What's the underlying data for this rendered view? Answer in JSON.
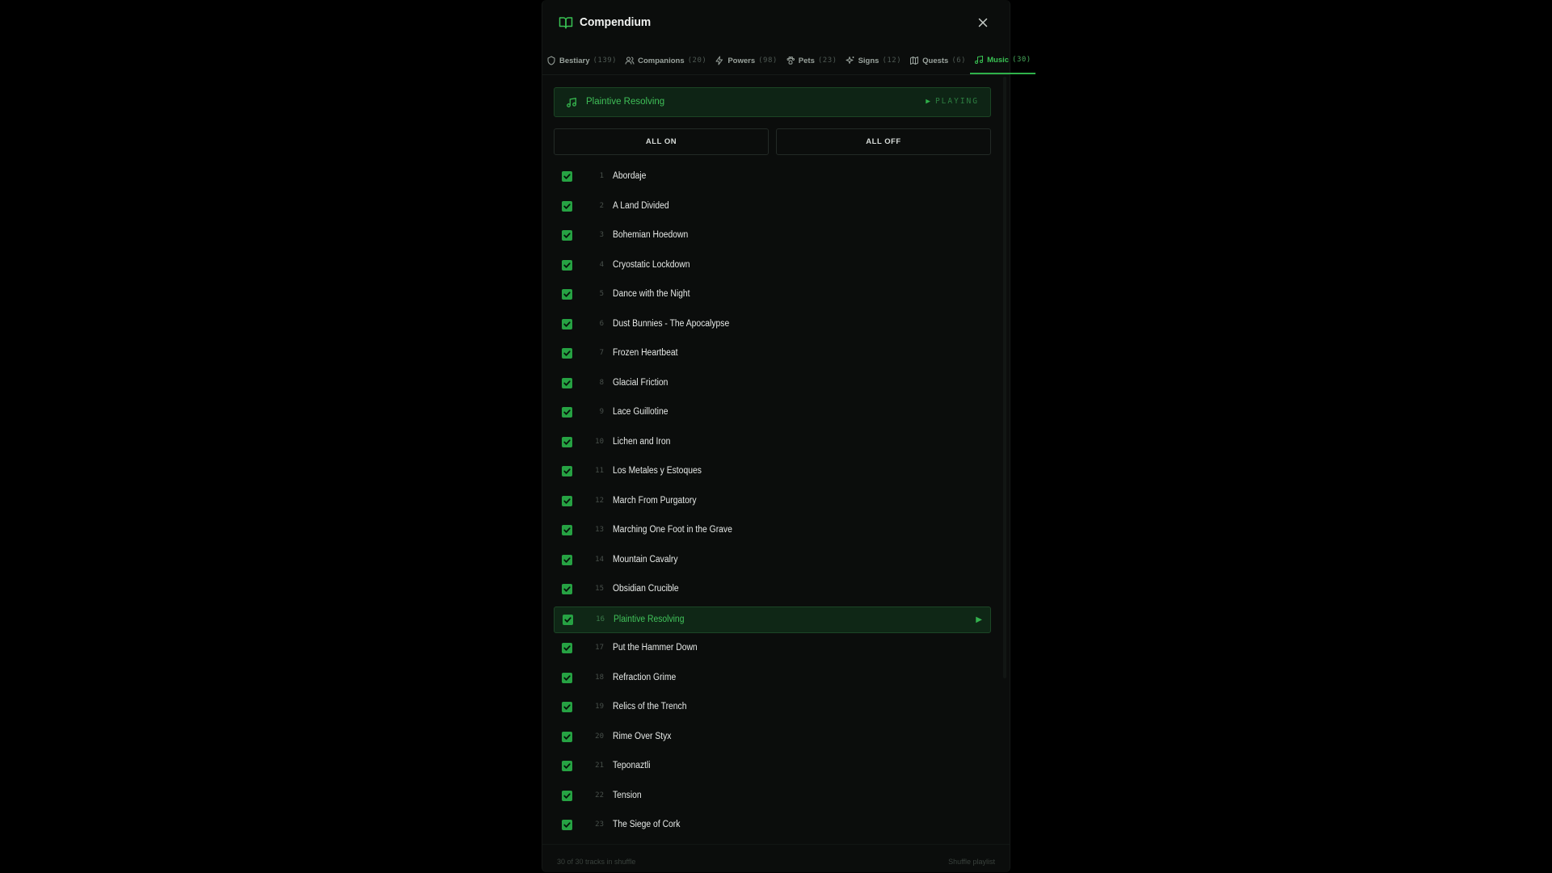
{
  "header": {
    "title": "Compendium",
    "book_icon": "book-open-icon",
    "close_icon": "close-icon"
  },
  "tabs": [
    {
      "label": "Bestiary",
      "count": "(139)",
      "icon": "shield-icon",
      "active": false
    },
    {
      "label": "Companions",
      "count": "(20)",
      "icon": "users-icon",
      "active": false
    },
    {
      "label": "Powers",
      "count": "(98)",
      "icon": "bolt-icon",
      "active": false
    },
    {
      "label": "Pets",
      "count": "(23)",
      "icon": "paw-icon",
      "active": false
    },
    {
      "label": "Signs",
      "count": "(12)",
      "icon": "sparkles-icon",
      "active": false
    },
    {
      "label": "Quests",
      "count": "(6)",
      "icon": "map-icon",
      "active": false
    },
    {
      "label": "Music",
      "count": "(30)",
      "icon": "music-icon",
      "active": true
    }
  ],
  "now_playing": {
    "title": "Plaintive Resolving",
    "status": "PLAYING",
    "icon": "music-icon"
  },
  "controls": {
    "all_on": "ALL ON",
    "all_off": "ALL OFF"
  },
  "tracks": [
    {
      "num": "1",
      "name": "Abordaje",
      "checked": true
    },
    {
      "num": "2",
      "name": "A Land Divided",
      "checked": true
    },
    {
      "num": "3",
      "name": "Bohemian Hoedown",
      "checked": true
    },
    {
      "num": "4",
      "name": "Cryostatic Lockdown",
      "checked": true
    },
    {
      "num": "5",
      "name": "Dance with the Night",
      "checked": true
    },
    {
      "num": "6",
      "name": "Dust Bunnies - The Apocalypse",
      "checked": true
    },
    {
      "num": "7",
      "name": "Frozen Heartbeat",
      "checked": true
    },
    {
      "num": "8",
      "name": "Glacial Friction",
      "checked": true
    },
    {
      "num": "9",
      "name": "Lace Guillotine",
      "checked": true
    },
    {
      "num": "10",
      "name": "Lichen and Iron",
      "checked": true
    },
    {
      "num": "11",
      "name": "Los Metales y Estoques",
      "checked": true
    },
    {
      "num": "12",
      "name": "March From Purgatory",
      "checked": true
    },
    {
      "num": "13",
      "name": "Marching One Foot in the Grave",
      "checked": true
    },
    {
      "num": "14",
      "name": "Mountain Cavalry",
      "checked": true
    },
    {
      "num": "15",
      "name": "Obsidian Crucible",
      "checked": true
    },
    {
      "num": "16",
      "name": "Plaintive Resolving",
      "checked": true,
      "current": true
    },
    {
      "num": "17",
      "name": "Put the Hammer Down",
      "checked": true
    },
    {
      "num": "18",
      "name": "Refraction Grime",
      "checked": true
    },
    {
      "num": "19",
      "name": "Relics of the Trench",
      "checked": true
    },
    {
      "num": "20",
      "name": "Rime Over Styx",
      "checked": true
    },
    {
      "num": "21",
      "name": "Teponaztli",
      "checked": true
    },
    {
      "num": "22",
      "name": "Tension",
      "checked": true
    },
    {
      "num": "23",
      "name": "The Siege of Cork",
      "checked": true
    }
  ],
  "footer": {
    "count_text": "30 of 30 tracks in shuffle",
    "shuffle_label": "Shuffle playlist"
  },
  "colors": {
    "accent": "#2fb14a",
    "background": "#0b0d0c",
    "highlight": "#0f2716"
  }
}
